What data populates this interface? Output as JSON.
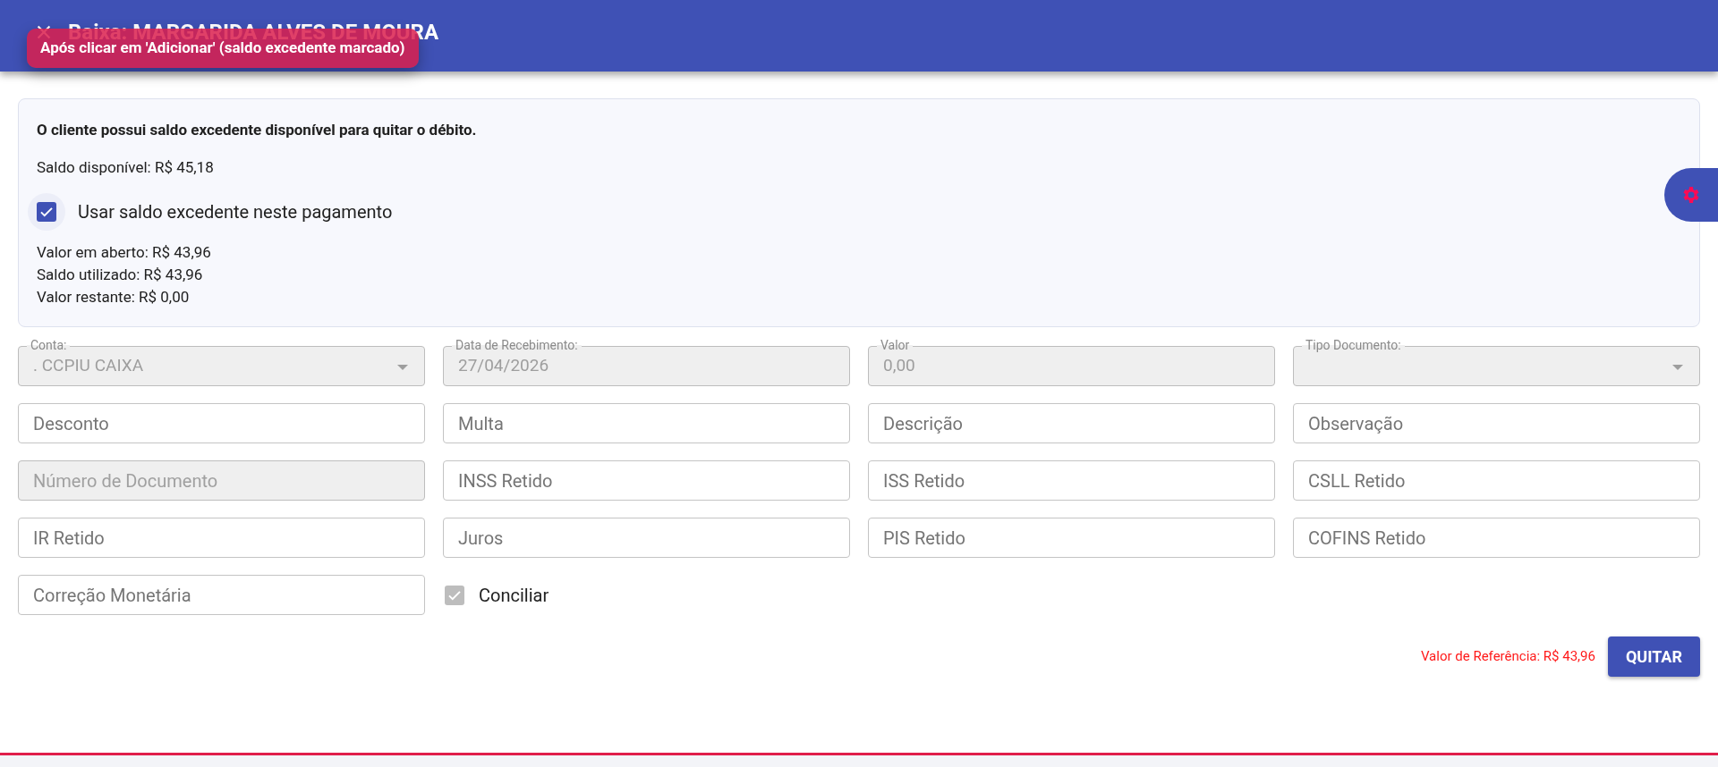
{
  "header": {
    "title": "Baixa: MARGARIDA ALVES DE MOURA"
  },
  "badge": {
    "text": "Após clicar em 'Adicionar' (saldo excedente marcado)"
  },
  "balance_panel": {
    "heading": "O cliente possui saldo excedente disponível para quitar o débito.",
    "available": "Saldo disponível: R$ 45,18",
    "use_balance": {
      "label": "Usar saldo excedente neste pagamento",
      "checked": true
    },
    "lines": [
      "Valor em aberto: R$ 43,96",
      "Saldo utilizado: R$ 43,96",
      "Valor restante: R$ 0,00"
    ]
  },
  "fields": [
    {
      "kind": "select",
      "label": "Conta:",
      "value": ". CCPIU CAIXA",
      "disabled": true
    },
    {
      "kind": "input",
      "label": "Data de Recebimento:",
      "value": "27/04/2026",
      "disabled": true
    },
    {
      "kind": "input",
      "label": "Valor",
      "value": "0,00",
      "disabled": true
    },
    {
      "kind": "select",
      "label": "Tipo Documento:",
      "disabled": true
    },
    {
      "kind": "input",
      "placeholder": "Desconto",
      "disabled": false
    },
    {
      "kind": "input",
      "placeholder": "Multa",
      "disabled": false
    },
    {
      "kind": "input",
      "placeholder": "Descrição",
      "disabled": false
    },
    {
      "kind": "input",
      "placeholder": "Observação",
      "disabled": false
    },
    {
      "kind": "input",
      "placeholder": "Número de Documento",
      "disabled": true
    },
    {
      "kind": "input",
      "placeholder": "INSS Retido",
      "disabled": false
    },
    {
      "kind": "input",
      "placeholder": "ISS Retido",
      "disabled": false
    },
    {
      "kind": "input",
      "placeholder": "CSLL Retido",
      "disabled": false
    },
    {
      "kind": "input",
      "placeholder": "IR Retido",
      "disabled": false
    },
    {
      "kind": "input",
      "placeholder": "Juros",
      "disabled": false
    },
    {
      "kind": "input",
      "placeholder": "PIS Retido",
      "disabled": false
    },
    {
      "kind": "input",
      "placeholder": "COFINS Retido",
      "disabled": false
    },
    {
      "kind": "input",
      "placeholder": "Correção Monetária",
      "disabled": false
    },
    {
      "kind": "checkbox",
      "label": "Conciliar",
      "checked": true,
      "disabled": true
    }
  ],
  "footer": {
    "reference": "Valor de Referência: R$ 43,96",
    "button": "QUITAR"
  }
}
